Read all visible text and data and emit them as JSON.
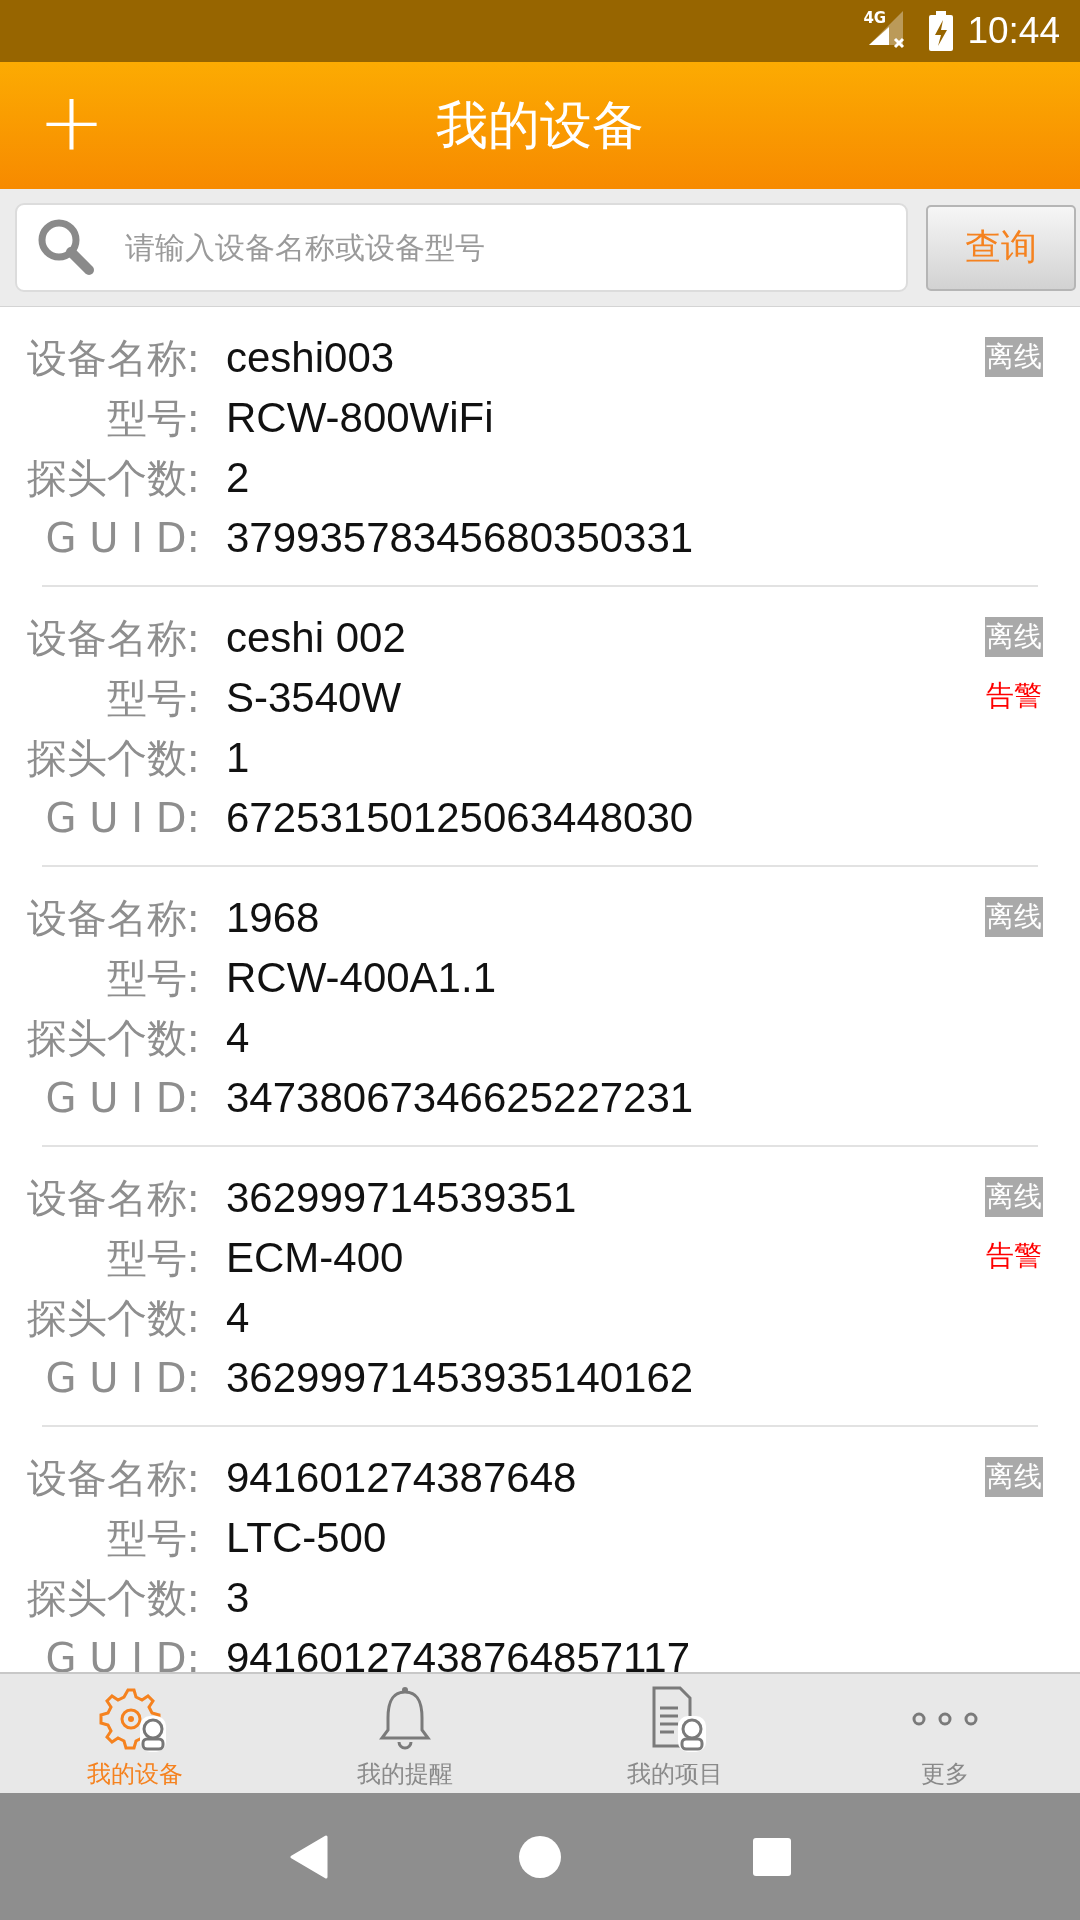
{
  "status_bar": {
    "network": "4G",
    "time": "10:44"
  },
  "header": {
    "add": "+",
    "title": "我的设备"
  },
  "search": {
    "placeholder": "请输入设备名称或设备型号",
    "button": "查询"
  },
  "devices": [
    {
      "name_label": "设备名称:",
      "name": "ceshi003",
      "model_label": "型号:",
      "model": "RCW-800WiFi",
      "probes_label": "探头个数:",
      "probes": "2",
      "guid_label": "G U I D:",
      "guid": "37993578345680350331",
      "statuses": [
        {
          "kind": "offline",
          "text": "离线"
        }
      ]
    },
    {
      "name_label": "设备名称:",
      "name": "ceshi 002",
      "model_label": "型号:",
      "model": "S-3540W",
      "probes_label": "探头个数:",
      "probes": "1",
      "guid_label": "G U I D:",
      "guid": "67253150125063448030",
      "statuses": [
        {
          "kind": "offline",
          "text": "离线"
        },
        {
          "kind": "alarm",
          "text": "告警"
        }
      ]
    },
    {
      "name_label": "设备名称:",
      "name": "1968",
      "model_label": "型号:",
      "model": "RCW-400A1.1",
      "probes_label": "探头个数:",
      "probes": "4",
      "guid_label": "G U I D:",
      "guid": "34738067346625227231",
      "statuses": [
        {
          "kind": "offline",
          "text": "离线"
        }
      ]
    },
    {
      "name_label": "设备名称:",
      "name": "362999714539351",
      "model_label": "型号:",
      "model": "ECM-400",
      "probes_label": "探头个数:",
      "probes": "4",
      "guid_label": "G U I D:",
      "guid": "36299971453935140162",
      "statuses": [
        {
          "kind": "offline",
          "text": "离线"
        },
        {
          "kind": "alarm",
          "text": "告警"
        }
      ]
    },
    {
      "name_label": "设备名称:",
      "name": "941601274387648",
      "model_label": "型号:",
      "model": "LTC-500",
      "probes_label": "探头个数:",
      "probes": "3",
      "guid_label": "G U I D:",
      "guid": "94160127438764857117",
      "statuses": [
        {
          "kind": "offline",
          "text": "离线"
        }
      ]
    }
  ],
  "tabs": [
    {
      "kind": "devices",
      "label": "我的设备",
      "selected": true
    },
    {
      "kind": "reminders",
      "label": "我的提醒",
      "selected": false
    },
    {
      "kind": "projects",
      "label": "我的项目",
      "selected": false
    },
    {
      "kind": "more",
      "label": "更多",
      "selected": false
    }
  ]
}
